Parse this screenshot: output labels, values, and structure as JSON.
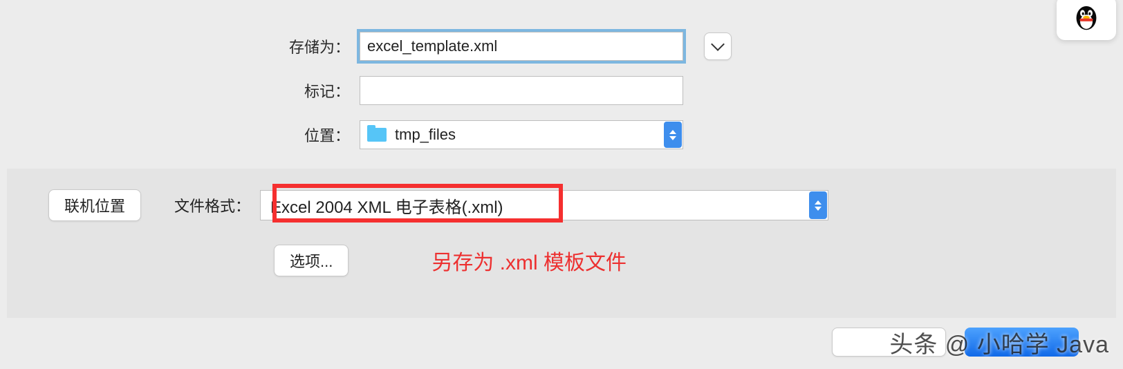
{
  "labels": {
    "save_as": "存储为：",
    "tags": "标记：",
    "location": "位置：",
    "file_format": "文件格式："
  },
  "fields": {
    "filename": "excel_template.xml",
    "tags": "",
    "location_folder": "tmp_files",
    "file_format_value": "Excel 2004 XML 电子表格(.xml)"
  },
  "buttons": {
    "online_locations": "联机位置",
    "options": "选项..."
  },
  "annotation": "另存为 .xml 模板文件",
  "watermark": "头条 @ 小哈学 Java"
}
